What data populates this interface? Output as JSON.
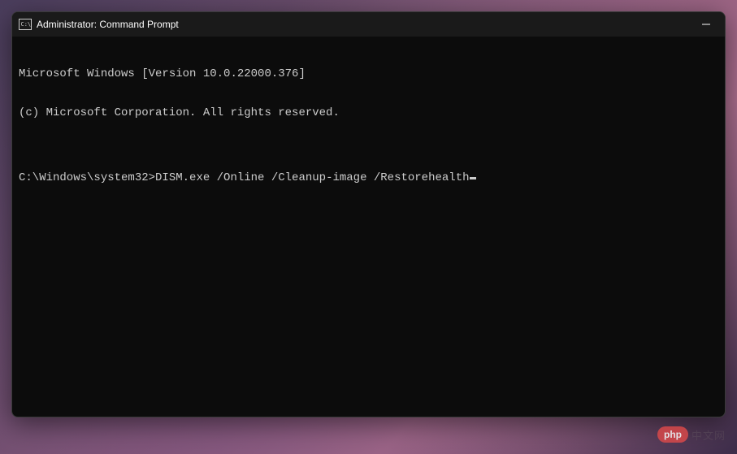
{
  "window": {
    "title": "Administrator: Command Prompt"
  },
  "terminal": {
    "line1": "Microsoft Windows [Version 10.0.22000.376]",
    "line2": "(c) Microsoft Corporation. All rights reserved.",
    "blank": "",
    "prompt": "C:\\Windows\\system32>",
    "command": "DISM.exe /Online /Cleanup-image /Restorehealth"
  },
  "watermark": {
    "badge": "php",
    "text": "中文网"
  }
}
